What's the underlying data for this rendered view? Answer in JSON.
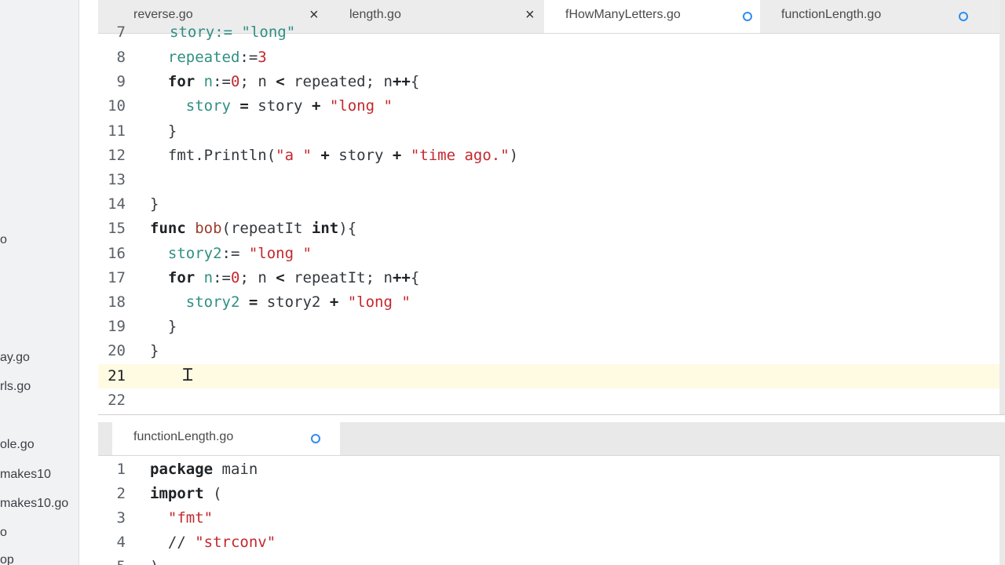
{
  "sidebar": {
    "items": [
      "o",
      "ay.go",
      "rls.go",
      "ole.go",
      "makes10",
      "makes10.go",
      "o",
      "op"
    ]
  },
  "top_editor": {
    "tabs": [
      {
        "label": "reverse.go",
        "state": "close"
      },
      {
        "label": "length.go",
        "state": "close"
      },
      {
        "label": "fHowManyLetters.go",
        "state": "modified",
        "active": true
      },
      {
        "label": "functionLength.go",
        "state": "modified"
      }
    ],
    "partial_line": "story:= \"long\"",
    "lines": [
      {
        "n": "8",
        "tokens": [
          [
            "var",
            "  repeated"
          ],
          [
            "plain",
            ":="
          ],
          [
            "num",
            "3"
          ]
        ]
      },
      {
        "n": "9",
        "tokens": [
          [
            "kw",
            "  for "
          ],
          [
            "var",
            "n"
          ],
          [
            "plain",
            ":="
          ],
          [
            "num",
            "0"
          ],
          [
            "plain",
            "; n "
          ],
          [
            "kw",
            "<"
          ],
          [
            "plain",
            " repeated; n"
          ],
          [
            "kw",
            "++"
          ],
          [
            "plain",
            "{"
          ]
        ]
      },
      {
        "n": "10",
        "tokens": [
          [
            "var",
            "    story"
          ],
          [
            "plain",
            " "
          ],
          [
            "kw",
            "="
          ],
          [
            "plain",
            " story "
          ],
          [
            "kw",
            "+"
          ],
          [
            "plain",
            " "
          ],
          [
            "str",
            "\"long \""
          ]
        ]
      },
      {
        "n": "11",
        "tokens": [
          [
            "plain",
            "  }"
          ]
        ]
      },
      {
        "n": "12",
        "tokens": [
          [
            "plain",
            "  fmt.Println("
          ],
          [
            "str",
            "\"a \""
          ],
          [
            "plain",
            " "
          ],
          [
            "kw",
            "+"
          ],
          [
            "plain",
            " story "
          ],
          [
            "kw",
            "+"
          ],
          [
            "plain",
            " "
          ],
          [
            "str",
            "\"time ago.\""
          ],
          [
            "plain",
            ")"
          ]
        ]
      },
      {
        "n": "13",
        "tokens": []
      },
      {
        "n": "14",
        "tokens": [
          [
            "plain",
            "}"
          ]
        ]
      },
      {
        "n": "15",
        "tokens": [
          [
            "kw",
            "func "
          ],
          [
            "fn",
            "bob"
          ],
          [
            "plain",
            "(repeatIt "
          ],
          [
            "kw",
            "int"
          ],
          [
            "plain",
            "){"
          ]
        ]
      },
      {
        "n": "16",
        "tokens": [
          [
            "var",
            "  story2"
          ],
          [
            "plain",
            ":= "
          ],
          [
            "str",
            "\"long \""
          ]
        ]
      },
      {
        "n": "17",
        "tokens": [
          [
            "kw",
            "  for "
          ],
          [
            "var",
            "n"
          ],
          [
            "plain",
            ":="
          ],
          [
            "num",
            "0"
          ],
          [
            "plain",
            "; n "
          ],
          [
            "kw",
            "<"
          ],
          [
            "plain",
            " repeatIt; n"
          ],
          [
            "kw",
            "++"
          ],
          [
            "plain",
            "{"
          ]
        ]
      },
      {
        "n": "18",
        "tokens": [
          [
            "var",
            "    story2"
          ],
          [
            "plain",
            " "
          ],
          [
            "kw",
            "="
          ],
          [
            "plain",
            " story2 "
          ],
          [
            "kw",
            "+"
          ],
          [
            "plain",
            " "
          ],
          [
            "str",
            "\"long \""
          ]
        ]
      },
      {
        "n": "19",
        "tokens": [
          [
            "plain",
            "  }"
          ]
        ]
      },
      {
        "n": "20",
        "tokens": [
          [
            "plain",
            "}"
          ]
        ]
      },
      {
        "n": "21",
        "tokens": [],
        "current": true
      },
      {
        "n": "22",
        "tokens": []
      }
    ]
  },
  "bottom_editor": {
    "tabs": [
      {
        "label": "functionLength.go",
        "state": "modified",
        "active": true
      }
    ],
    "lines": [
      {
        "n": "1",
        "tokens": [
          [
            "kw",
            "package "
          ],
          [
            "plain",
            "main"
          ]
        ]
      },
      {
        "n": "2",
        "tokens": [
          [
            "kw",
            "import "
          ],
          [
            "plain",
            "("
          ]
        ]
      },
      {
        "n": "3",
        "tokens": [
          [
            "str",
            "  \"fmt\""
          ]
        ]
      },
      {
        "n": "4",
        "tokens": [
          [
            "plain",
            "  // "
          ],
          [
            "str",
            "\"strconv\""
          ]
        ]
      },
      {
        "n": "5",
        "tokens": [
          [
            "plain",
            ")"
          ]
        ]
      }
    ]
  },
  "colors": {
    "accent": "#2e8cf0",
    "keyword": "#1e2226",
    "string": "#c4272e",
    "variable": "#2f8f83",
    "current_line": "#fffbe3"
  },
  "icons": {
    "close": "×",
    "modified": "dot-icon",
    "cursor": "text-cursor-icon"
  }
}
